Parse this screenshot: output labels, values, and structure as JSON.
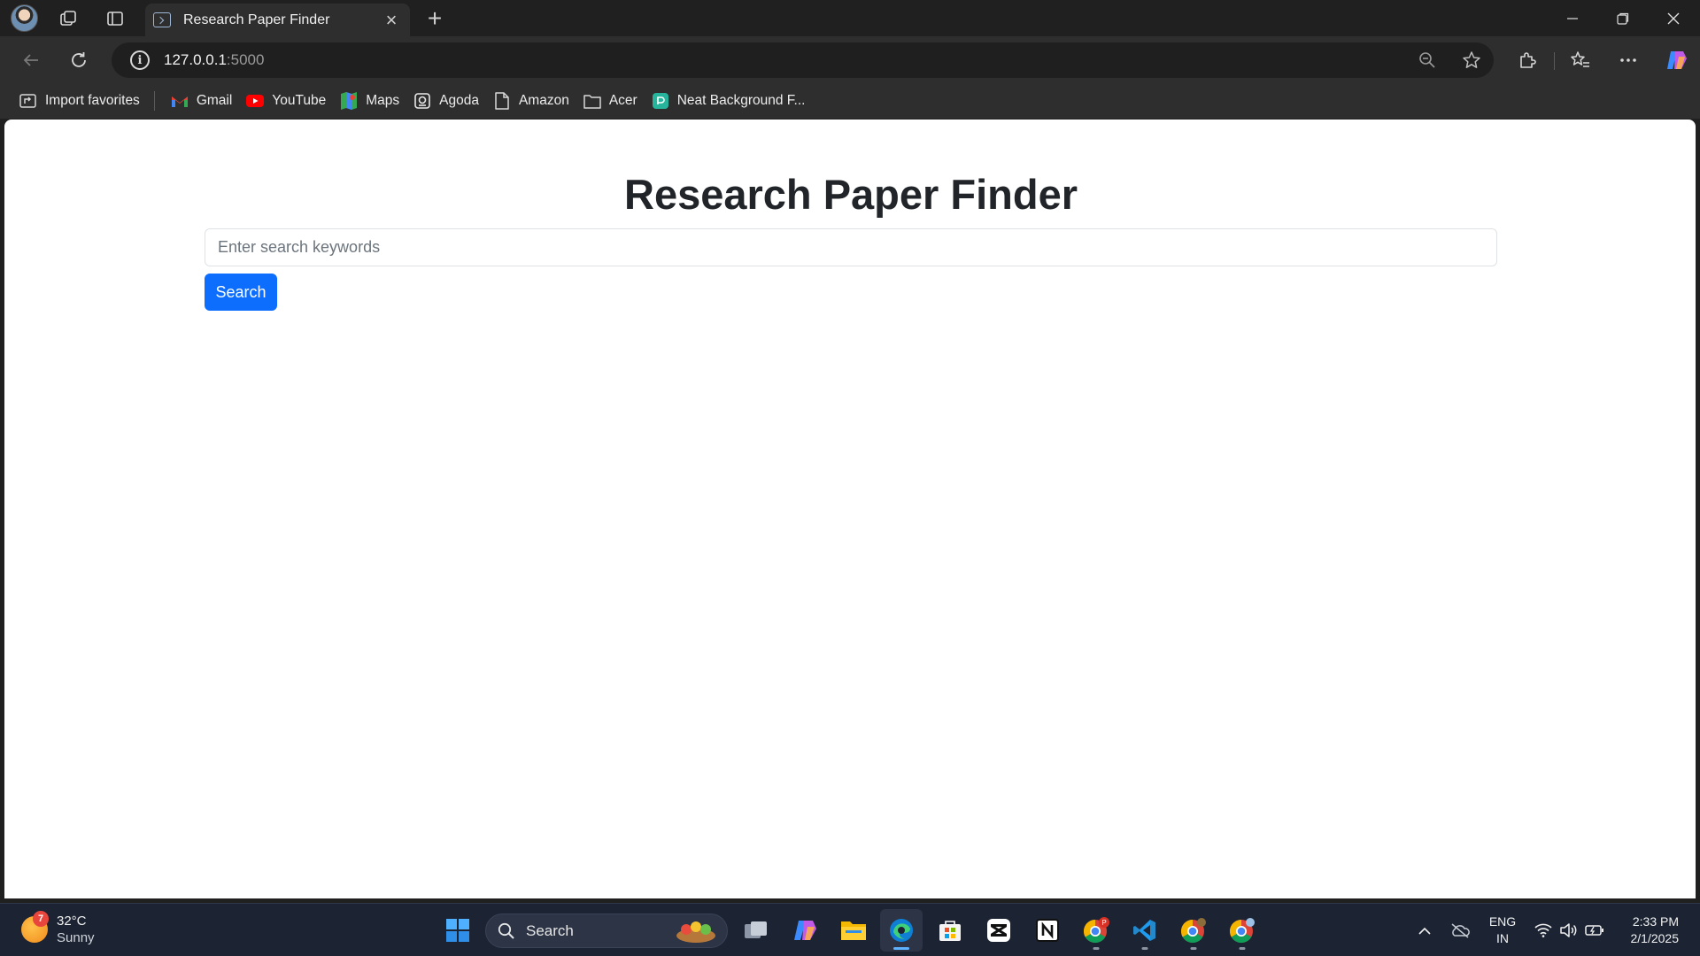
{
  "browser": {
    "tab_title": "Research Paper Finder",
    "new_tab_symbol": "+",
    "close_tab_symbol": "×",
    "url_host": "127.0.0.1",
    "url_port": ":5000"
  },
  "favorites": [
    {
      "label": "Import favorites",
      "icon": "import-icon"
    },
    {
      "label": "Gmail",
      "icon": "gmail-icon"
    },
    {
      "label": "YouTube",
      "icon": "youtube-icon"
    },
    {
      "label": "Maps",
      "icon": "maps-icon"
    },
    {
      "label": "Agoda",
      "icon": "agoda-icon"
    },
    {
      "label": "Amazon",
      "icon": "page-icon"
    },
    {
      "label": "Acer",
      "icon": "folder-icon"
    },
    {
      "label": "Neat Background F...",
      "icon": "neat-icon"
    }
  ],
  "page": {
    "title": "Research Paper Finder",
    "search_placeholder": "Enter search keywords",
    "search_value": "",
    "search_button": "Search"
  },
  "taskbar": {
    "weather_temp": "32°C",
    "weather_cond": "Sunny",
    "weather_badge": "7",
    "search_label": "Search",
    "lang_top": "ENG",
    "lang_bottom": "IN",
    "time": "2:33 PM",
    "date": "2/1/2025"
  },
  "colors": {
    "primary_button": "#0d6efd",
    "accent": "#5fb2ff"
  }
}
